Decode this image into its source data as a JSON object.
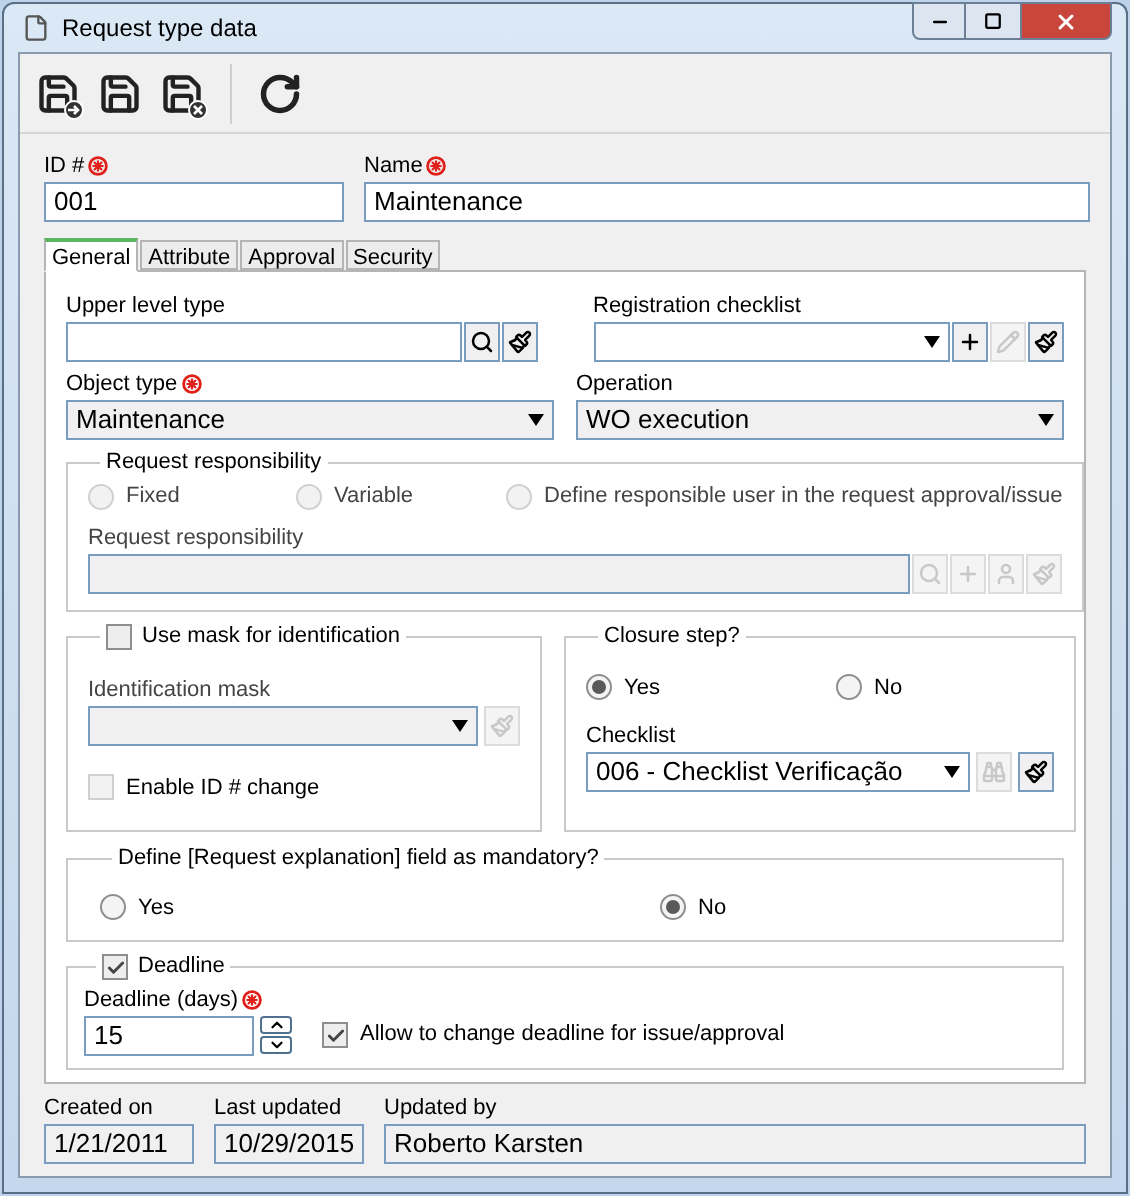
{
  "window": {
    "title": "Request type data"
  },
  "toolbar": [
    {
      "kind": "save-new"
    },
    {
      "kind": "save"
    },
    {
      "kind": "save-close"
    },
    {
      "kind": "refresh"
    }
  ],
  "header": {
    "id": {
      "label": "ID #",
      "required": true,
      "value": "001"
    },
    "name": {
      "label": "Name",
      "required": true,
      "value": "Maintenance"
    }
  },
  "tabs": [
    {
      "label": "General",
      "selected": true
    },
    {
      "label": "Attribute",
      "selected": false
    },
    {
      "label": "Approval",
      "selected": false
    },
    {
      "label": "Security",
      "selected": false
    }
  ],
  "general": {
    "upper_level_type": {
      "label": "Upper level type"
    },
    "registration_checklist": {
      "label": "Registration checklist",
      "edit_disabled": true
    },
    "object_type": {
      "label": "Object type",
      "required": true,
      "value": "Maintenance"
    },
    "operation": {
      "label": "Operation",
      "value": "WO execution"
    },
    "request_responsibility": {
      "legend": "Request responsibility",
      "disabled": true,
      "options": [
        {
          "label": "Fixed",
          "selected": false
        },
        {
          "label": "Variable",
          "selected": false
        },
        {
          "label": "Define responsible user in the request approval/issue",
          "selected": false
        }
      ],
      "field_label": "Request responsibility"
    },
    "mask": {
      "legend": "Use mask for identification",
      "checked": false,
      "field_label": "Identification mask",
      "enable_id_change": {
        "label": "Enable ID # change",
        "checked": false,
        "disabled": true
      }
    },
    "closure_step": {
      "legend": "Closure step?",
      "options": [
        {
          "label": "Yes",
          "selected": true
        },
        {
          "label": "No",
          "selected": false
        }
      ],
      "checklist_label": "Checklist",
      "checklist_value": "006 - Checklist Verificação"
    },
    "explanation_mandatory": {
      "legend": "Define [Request explanation] field as mandatory?",
      "options": [
        {
          "label": "Yes",
          "selected": false
        },
        {
          "label": "No",
          "selected": true
        }
      ]
    },
    "deadline": {
      "legend": "Deadline",
      "checked": true,
      "field_label": "Deadline (days)",
      "required": true,
      "value": "15",
      "allow_change": {
        "label": "Allow to change deadline for issue/approval",
        "checked": true
      }
    }
  },
  "footer": [
    {
      "label": "Created on",
      "value": "1/21/2011"
    },
    {
      "label": "Last updated",
      "value": "10/29/2015"
    },
    {
      "label": "Updated by",
      "value": "Roberto Karsten"
    }
  ]
}
